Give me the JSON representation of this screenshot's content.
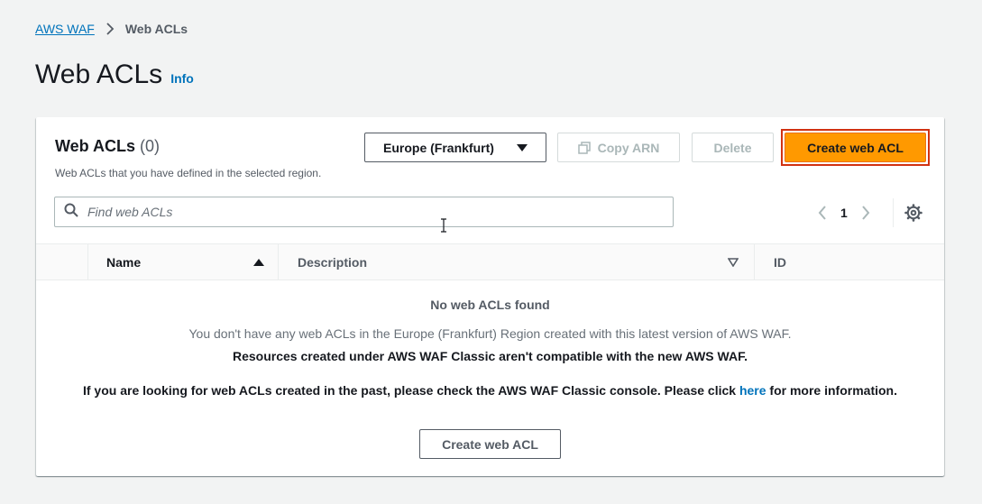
{
  "breadcrumb": {
    "root": "AWS WAF",
    "current": "Web ACLs"
  },
  "page": {
    "title": "Web ACLs",
    "info_link": "Info"
  },
  "panel": {
    "title": "Web ACLs",
    "count": "(0)",
    "description": "Web ACLs that you have defined in the selected region.",
    "region_select": "Europe (Frankfurt)",
    "copy_arn_label": "Copy ARN",
    "delete_label": "Delete",
    "create_label": "Create web ACL",
    "search_placeholder": "Find web ACLs",
    "page_number": "1"
  },
  "table": {
    "columns": [
      "Name",
      "Description",
      "ID"
    ]
  },
  "empty_state": {
    "title": "No web ACLs found",
    "line1": "You don't have any web ACLs in the Europe (Frankfurt) Region created with this latest version of AWS WAF.",
    "line2": "Resources created under AWS WAF Classic aren't compatible with the new AWS WAF.",
    "line3_before": "If you are looking for web ACLs created in the past, please check the AWS WAF Classic console. Please click ",
    "line3_link": "here",
    "line3_after": " for more information.",
    "create_label": "Create web ACL"
  },
  "colors": {
    "primary": "#ff9900",
    "link": "#0073bb",
    "highlight_outline": "#d13212"
  }
}
